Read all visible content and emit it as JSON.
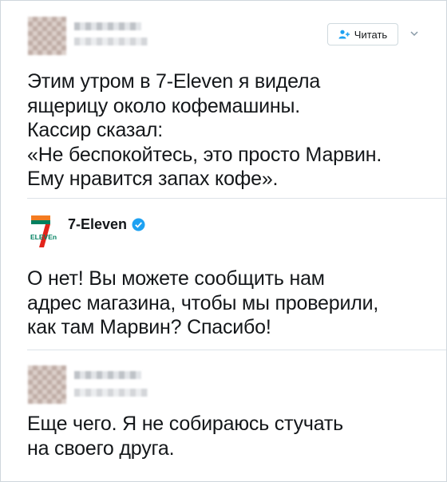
{
  "tweet1": {
    "follow_label": "Читать",
    "text": "Этим утром в 7-Eleven я видела\nящерицу около кофемашины.\nКассир сказал:\n«Не беспокойтесь, это просто Марвин.\nЕму нравится запах кофе»."
  },
  "reply": {
    "brand_name": "7-Eleven",
    "logo_text": "ELEVEn",
    "text": "О нет! Вы можете сообщить нам\nадрес магазина, чтобы мы проверили,\nкак там Марвин? Спасибо!"
  },
  "tweet2": {
    "text": "Еще чего. Я не собираюсь стучать\nна своего друга."
  },
  "colors": {
    "accent": "#1da1f2",
    "logo_orange": "#f47b20",
    "logo_green": "#008060",
    "logo_red": "#e2231a"
  }
}
